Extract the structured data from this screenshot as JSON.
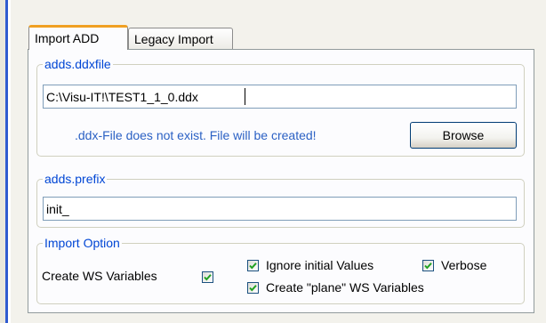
{
  "tabs": [
    {
      "label": "Import ADD",
      "active": true
    },
    {
      "label": "Legacy Import",
      "active": false
    }
  ],
  "ddxfile": {
    "legend": "adds.ddxfile",
    "value": "C:\\Visu-IT!\\TEST1_1_0.ddx",
    "info": ".ddx-File does not exist. File will be created!",
    "browse_label": "Browse"
  },
  "prefix": {
    "legend": "adds.prefix",
    "value": "init_"
  },
  "import_option": {
    "legend": "Import Option",
    "create_ws_label": "Create WS Variables",
    "create_ws_checked": true,
    "ignore_initial_label": "Ignore initial Values",
    "ignore_initial_checked": true,
    "verbose_label": "Verbose",
    "verbose_checked": true,
    "create_plane_label": "Create \"plane\" WS Variables",
    "create_plane_checked": true
  },
  "colors": {
    "accent_tab": "#f0a022",
    "legend_blue": "#0046d5",
    "info_blue": "#2b61c4",
    "check_green": "#21a121"
  },
  "icons": {
    "checkmark": "checkmark-icon"
  }
}
